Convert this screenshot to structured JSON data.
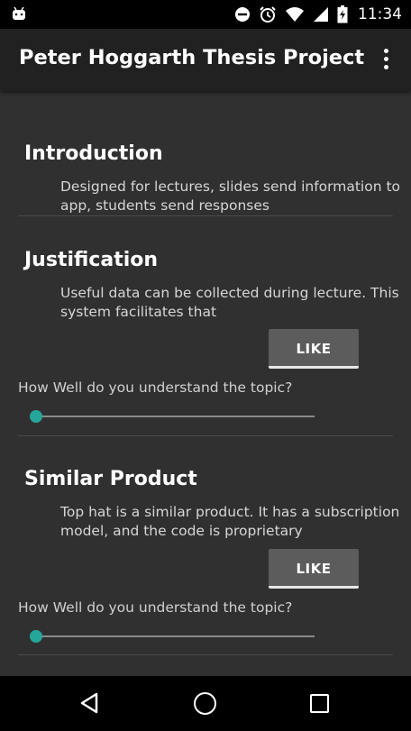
{
  "status_bar": {
    "time": "11:34"
  },
  "app_bar": {
    "title": "Peter Hoggarth Thesis Project",
    "menu_icon": "overflow-menu-icon"
  },
  "sections": [
    {
      "title": "Introduction",
      "body": "Designed for lectures, slides send information to app, students send responses"
    },
    {
      "title": "Justification",
      "body": "Useful data can be collected during lecture. This system facilitates that",
      "like_label": "LIKE",
      "question": "How Well do you understand the topic?",
      "slider_value": 0
    },
    {
      "title": "Similar Product",
      "body": "Top hat is a similar product. It has a subscription model, and the code is proprietary",
      "like_label": "LIKE",
      "question": "How Well do you understand the topic?",
      "slider_value": 0
    }
  ],
  "colors": {
    "accent": "#26a69a",
    "background": "#303030",
    "app_bar": "#212121"
  }
}
